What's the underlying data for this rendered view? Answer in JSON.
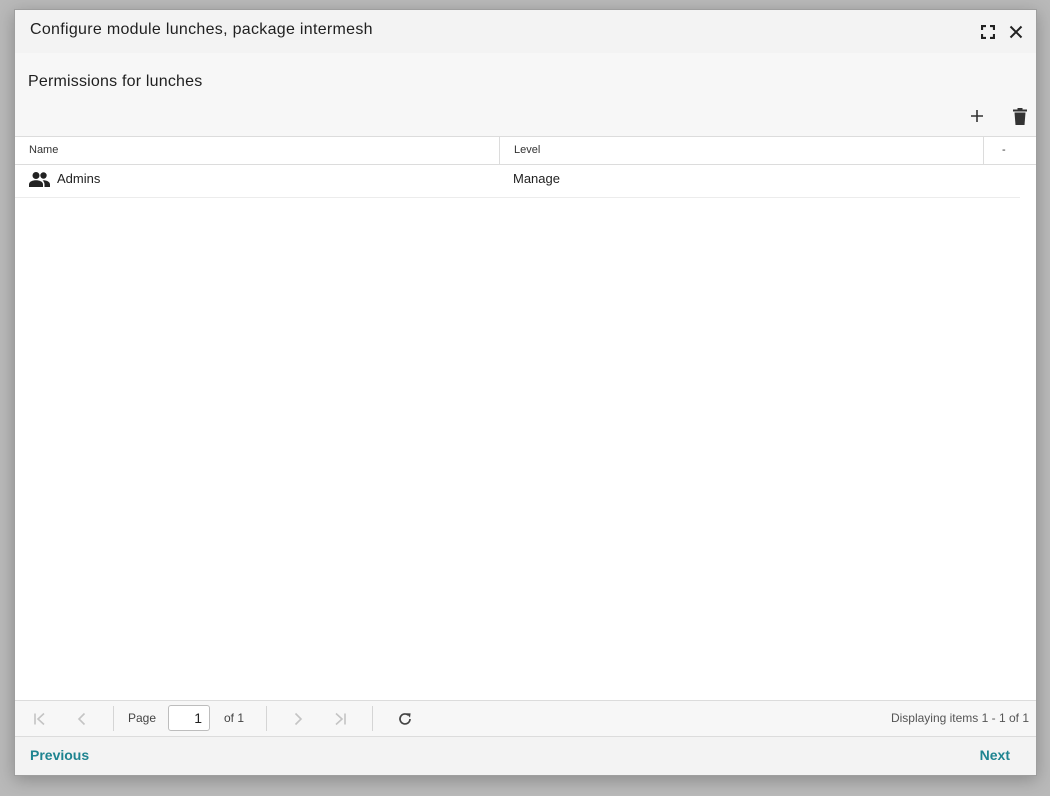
{
  "dialog": {
    "title": "Configure module lunches, package intermesh",
    "icons": {
      "maximize": "fullscreen-icon",
      "close": "close-icon"
    }
  },
  "panel": {
    "title": "Permissions for lunches",
    "icons": {
      "add": "plus-icon",
      "delete": "trash-icon"
    }
  },
  "grid": {
    "columns": [
      "Name",
      "Level",
      "-"
    ],
    "rows": [
      {
        "icon": "group-icon",
        "name": "Admins",
        "level": "Manage"
      }
    ]
  },
  "paging": {
    "page_label": "Page",
    "current_page": "1",
    "of_label": "of 1",
    "display_info": "Displaying items 1 - 1 of 1",
    "icons": {
      "first": "first-page-icon",
      "prev": "chevron-left-icon",
      "next": "chevron-right-icon",
      "last": "last-page-icon",
      "refresh": "refresh-icon"
    }
  },
  "footer": {
    "previous_label": "Previous",
    "next_label": "Next"
  },
  "colors": {
    "accent": "#1e8490",
    "icon_dark": "#333333",
    "icon_disabled": "#c4c4c4"
  }
}
